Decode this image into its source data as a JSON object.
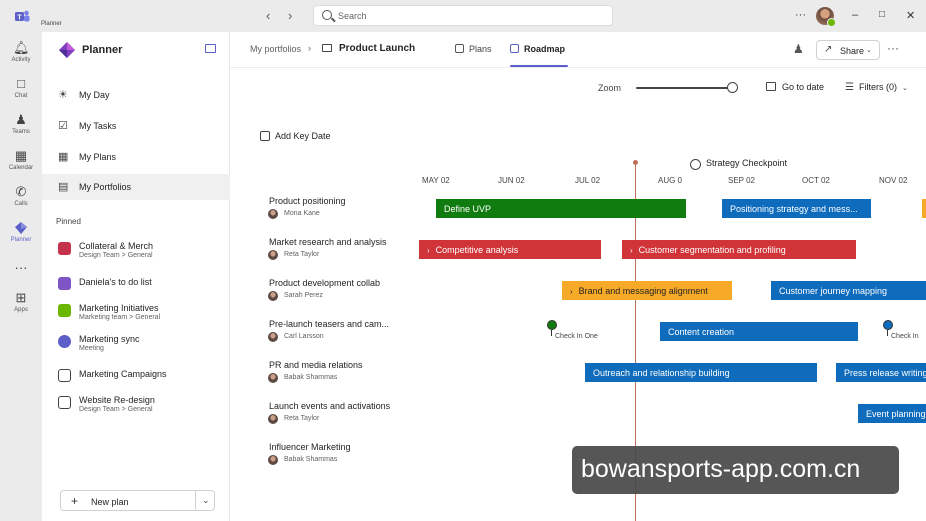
{
  "titlebar": {
    "app_name": "Planner",
    "search_placeholder": "Search"
  },
  "rail": {
    "items": [
      {
        "label": "Activity"
      },
      {
        "label": "Chat"
      },
      {
        "label": "Teams"
      },
      {
        "label": "Calendar"
      },
      {
        "label": "Calls"
      },
      {
        "label": "Planner"
      },
      {
        "label": "Apps"
      }
    ]
  },
  "leftnav": {
    "title": "Planner",
    "items": [
      {
        "label": "My Day"
      },
      {
        "label": "My Tasks"
      },
      {
        "label": "My Plans"
      },
      {
        "label": "My Portfolios"
      }
    ],
    "pinned_label": "Pinned",
    "plans": [
      {
        "name": "Collateral & Merch",
        "sub": "Design Team > General",
        "color": "#c4314b"
      },
      {
        "name": "Daniela's to do list",
        "sub": "",
        "color": "#7f55c6"
      },
      {
        "name": "Marketing Initiatives",
        "sub": "Marketing team > General",
        "color": "#6bb700"
      },
      {
        "name": "Marketing sync",
        "sub": "Meeting",
        "color": "#5b5fc7"
      },
      {
        "name": "Marketing Campaigns",
        "sub": "",
        "color": "#ffffff"
      },
      {
        "name": "Website Re-design",
        "sub": "Design Team > General",
        "color": "#ffffff"
      }
    ],
    "new_plan_label": "New plan"
  },
  "header": {
    "breadcrumb": "My portfolios",
    "plan_title": "Product Launch",
    "tabs": [
      {
        "label": "Plans"
      },
      {
        "label": "Roadmap"
      }
    ],
    "share_label": "Share"
  },
  "toolbar": {
    "zoom_label": "Zoom",
    "zoom_level": 1.0,
    "go_to_date_label": "Go to date",
    "filters_label": "Filters (0)"
  },
  "timeline": {
    "add_key_date_label": "Add Key Date",
    "months": [
      "MAY 02",
      "JUN 02",
      "JUL 02",
      "AUG 0",
      "SEP 02",
      "OCT 02",
      "NOV 02"
    ],
    "milestone_label": "Strategy Checkpoint"
  },
  "rows": [
    {
      "name": "Product positioning",
      "owner": "Mona Kane",
      "bars": [
        {
          "label": "Define UVP",
          "color": "#107c10",
          "chevron": false
        },
        {
          "label": "Positioning strategy and mess...",
          "color": "#0f6cbd",
          "chevron": false
        }
      ]
    },
    {
      "name": "Market research and analysis",
      "owner": "Reta Taylor",
      "bars": [
        {
          "label": "Competitive analysis",
          "color": "#d13438",
          "chevron": true
        },
        {
          "label": "Customer segmentation and profiling",
          "color": "#d13438",
          "chevron": true
        }
      ]
    },
    {
      "name": "Product development collab",
      "owner": "Sarah Perez",
      "bars": [
        {
          "label": "Brand and messaging alignment",
          "color": "#f7a928",
          "chevron": true
        },
        {
          "label": "Customer journey mapping",
          "color": "#0f6cbd",
          "chevron": false
        }
      ]
    },
    {
      "name": "Pre-launch teasers and cam...",
      "owner": "Carl Larsson",
      "bars": [
        {
          "label": "Content creation",
          "color": "#0f6cbd",
          "chevron": false
        }
      ],
      "checkins": [
        "Check In One",
        "Check In"
      ]
    },
    {
      "name": "PR and media relations",
      "owner": "Babak Shammas",
      "bars": [
        {
          "label": "Outreach and relationship building",
          "color": "#0f6cbd",
          "chevron": false
        },
        {
          "label": "Press release writing",
          "color": "#0f6cbd",
          "chevron": false
        }
      ]
    },
    {
      "name": "Launch events and activations",
      "owner": "Reta Taylor",
      "bars": [
        {
          "label": "Event planning",
          "color": "#0f6cbd",
          "chevron": false
        }
      ]
    },
    {
      "name": "Influencer Marketing",
      "owner": "Babak Shammas",
      "bars": []
    }
  ],
  "watermark": "bowansports-app.com.cn"
}
